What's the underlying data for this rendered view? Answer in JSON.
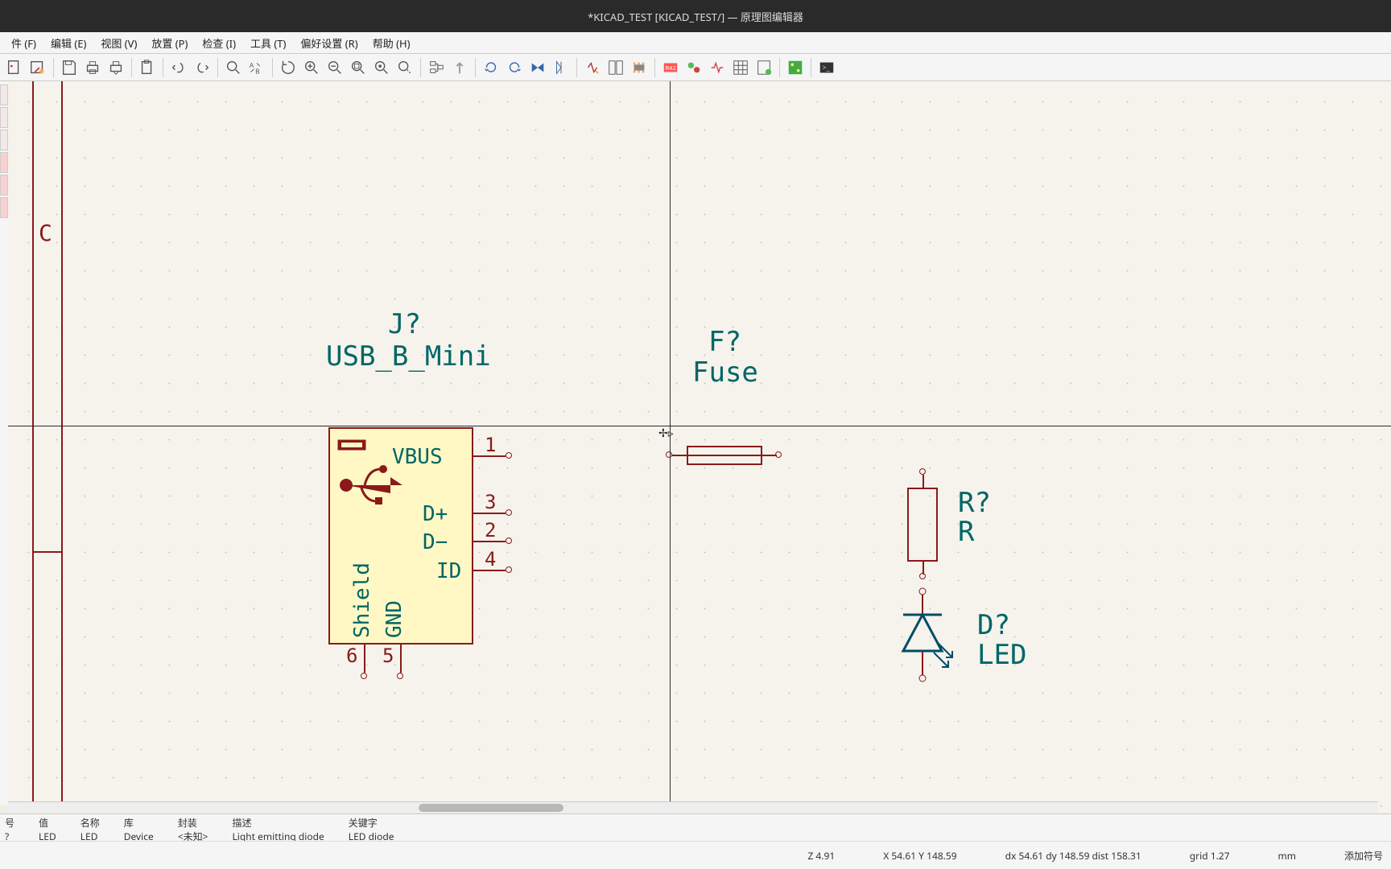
{
  "title": "*KICAD_TEST [KICAD_TEST/] — 原理图编辑器",
  "menu": {
    "file": "件 (F)",
    "edit": "编辑 (E)",
    "view": "视图 (V)",
    "place": "放置 (P)",
    "inspect": "检查 (I)",
    "tools": "工具 (T)",
    "preferences": "偏好设置 (R)",
    "help": "帮助 (H)"
  },
  "sheet_edge_label": "C",
  "components": {
    "usb": {
      "ref": "J?",
      "val": "USB_B_Mini",
      "pins": {
        "vbus": "VBUS",
        "dp": "D+",
        "dm": "D−",
        "id": "ID",
        "shield": "Shield",
        "gnd": "GND"
      },
      "pin_nums": {
        "p1": "1",
        "p2": "2",
        "p3": "3",
        "p4": "4",
        "p5": "5",
        "p6": "6"
      }
    },
    "fuse": {
      "ref": "F?",
      "val": "Fuse"
    },
    "resistor": {
      "ref": "R?",
      "val": "R"
    },
    "led": {
      "ref": "D?",
      "val": "LED"
    }
  },
  "info": {
    "col0_label": "号",
    "col0_val": "?",
    "val_label": "值",
    "val_val": "LED",
    "name_label": "名称",
    "name_val": "LED",
    "lib_label": "库",
    "lib_val": "Device",
    "fp_label": "封装",
    "fp_val": "<未知>",
    "desc_label": "描述",
    "desc_val": "Light emitting diode",
    "kw_label": "关键字",
    "kw_val": "LED diode"
  },
  "status": {
    "z": "Z 4.91",
    "xy": "X 54.61  Y 148.59",
    "dxy": "dx 54.61  dy 148.59  dist 158.31",
    "grid": "grid 1.27",
    "unit": "mm",
    "right": "添加符号"
  }
}
